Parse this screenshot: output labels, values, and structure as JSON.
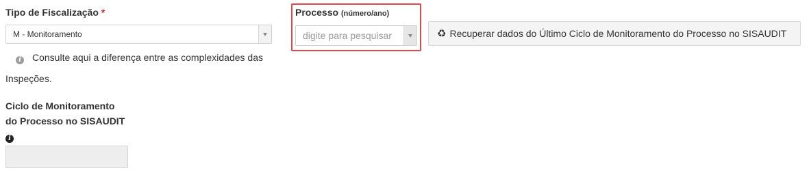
{
  "tipo_fiscalizacao": {
    "label": "Tipo de Fiscalização",
    "required_mark": "*",
    "selected_value": "M - Monitoramento",
    "hint_line1": "Consulte aqui a diferença entre as complexidades das",
    "hint_line2": "Inspeções."
  },
  "processo": {
    "label": "Processo",
    "label_suffix": "(número/ano)",
    "placeholder": "digite para pesquisar"
  },
  "recuperar_button": {
    "label": "Recuperar dados do Último Ciclo de Monitoramento do Processo no SISAUDIT",
    "icon": "recycle-icon"
  },
  "ciclo": {
    "label_line1": "Ciclo de Monitoramento",
    "label_line2": "do Processo no SISAUDIT",
    "value": ""
  },
  "colors": {
    "highlight_border": "#e04848",
    "required": "#c9302c",
    "info_icon_light": "#9e9e9e",
    "info_icon_dark": "#222222"
  }
}
